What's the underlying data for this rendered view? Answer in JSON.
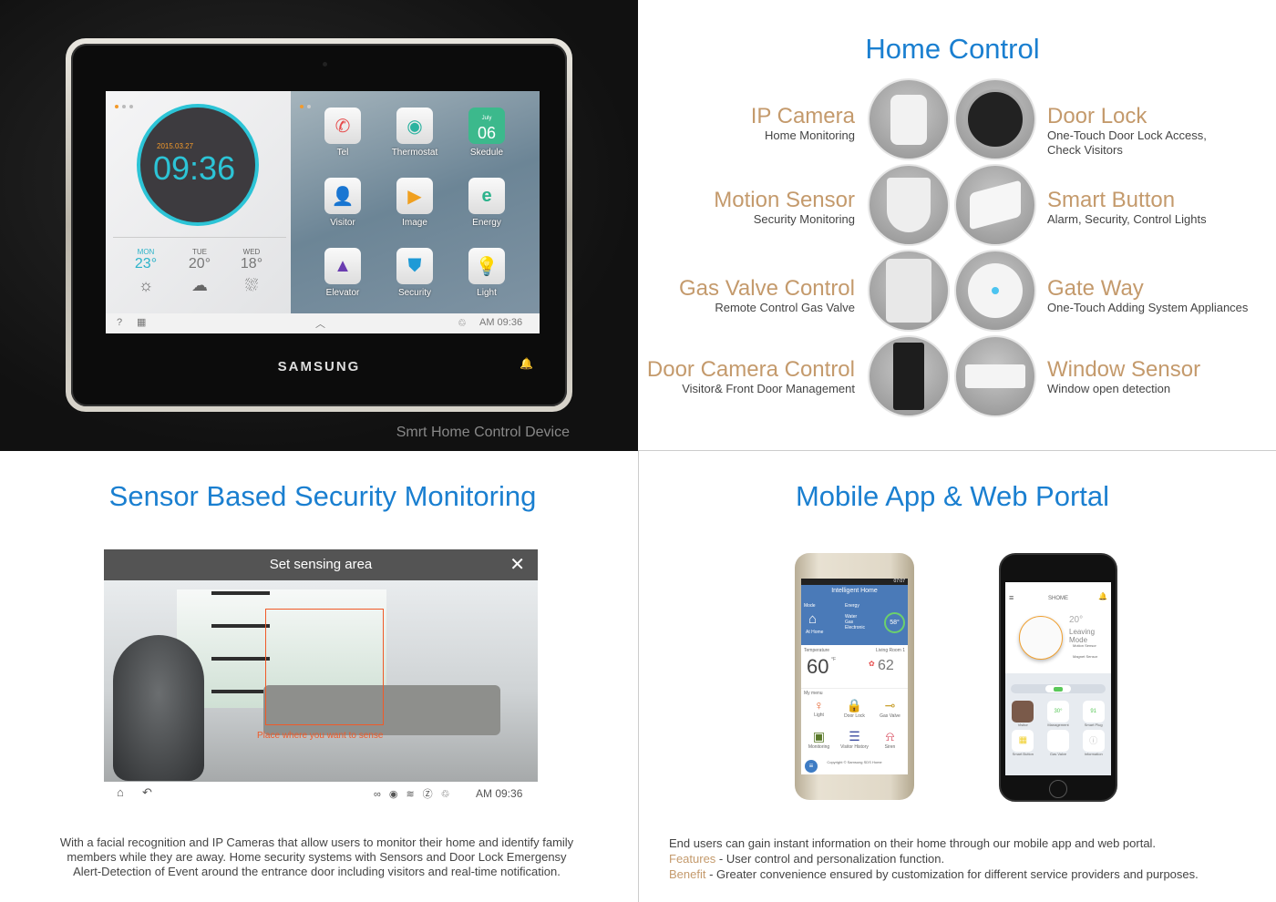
{
  "device": {
    "caption": "Smrt Home Control Device",
    "brand": "SAMSUNG",
    "clock": {
      "date": "2015.03.27",
      "time": "09:36"
    },
    "weather": [
      {
        "day": "MON",
        "temp": "23°",
        "icon": "sun-icon"
      },
      {
        "day": "TUE",
        "temp": "20°",
        "icon": "cloud-icon"
      },
      {
        "day": "WED",
        "temp": "18°",
        "icon": "rain-icon"
      }
    ],
    "apps": [
      {
        "label": "Tel",
        "icon": "phone-icon"
      },
      {
        "label": "Thermostat",
        "icon": "thermostat-icon"
      },
      {
        "label": "Skedule",
        "icon": "calendar-icon",
        "month": "July",
        "day": "06"
      },
      {
        "label": "Visitor",
        "icon": "visitor-icon"
      },
      {
        "label": "Image",
        "icon": "video-icon"
      },
      {
        "label": "Energy",
        "icon": "energy-icon"
      },
      {
        "label": "Elevator",
        "icon": "elevator-icon"
      },
      {
        "label": "Security",
        "icon": "shield-icon"
      },
      {
        "label": "Light",
        "icon": "bulb-icon"
      }
    ],
    "status": {
      "help": "?",
      "time": "AM 09:36"
    }
  },
  "home_control": {
    "title": "Home Control",
    "left": [
      {
        "name": "IP Camera",
        "desc": "Home Monitoring"
      },
      {
        "name": "Motion Sensor",
        "desc": "Security Monitoring"
      },
      {
        "name": "Gas Valve Control",
        "desc": "Remote Control Gas Valve"
      },
      {
        "name": "Door Camera Control",
        "desc": "Visitor& Front Door Management"
      }
    ],
    "right": [
      {
        "name": "Door Lock",
        "desc": "One-Touch Door Lock Access,",
        "desc2": "Check Visitors"
      },
      {
        "name": "Smart Button",
        "desc": "Alarm, Security, Control Lights"
      },
      {
        "name": "Gate Way",
        "desc": "One-Touch Adding System Appliances"
      },
      {
        "name": "Window Sensor",
        "desc": "Window open detection"
      }
    ]
  },
  "security": {
    "title": "Sensor Based Security Monitoring",
    "panel_title": "Set sensing area",
    "hint": "Place where you want to sense",
    "time": "AM 09:36",
    "description": "With a facial recognition and IP Cameras that allow users to monitor their home and identify family members while they are away. Home security systems with Sensors and Door Lock Emergensy Alert-Detection of Event around the entrance door including visitors and real-time notification.",
    "colors": {
      "accent": "#f05a28",
      "title": "#1a7fd0"
    }
  },
  "mobile": {
    "title": "Mobile App & Web Portal",
    "android": {
      "clock": "07:07",
      "title": "Intelligent Home",
      "mode": "Mode",
      "mode_value": "At Home",
      "energy": "Energy",
      "energy_items": [
        "Water",
        "Gas",
        "Electronic"
      ],
      "energy_pct": "58°",
      "temperature": "Temperature",
      "room": "Living Room 1",
      "current": "60",
      "target": "62",
      "unit": "°F",
      "my_menu": "My menu",
      "menu": [
        "Light",
        "Door Lock",
        "Gas Valve",
        "Monitoring",
        "Visitor History",
        "Siren"
      ],
      "copyright": "Copyright © Samsung SDS Home"
    },
    "iphone": {
      "title": "SHOME",
      "temp": "20°",
      "mode": "Leaving Mode",
      "sensors": [
        "Motion Sensor",
        "Magnet Sensor"
      ],
      "tiles": [
        "Visitor",
        "Management",
        "Smart Plug",
        "Smart Button",
        "Gas Valve",
        "Information"
      ],
      "mgmt_value": "30°",
      "plug_value": "91"
    },
    "intro": "End users can gain instant information on their home through our mobile app and web portal.",
    "features_label": "Features",
    "features": " - User control and personalization function.",
    "benefit_label": "Benefit",
    "benefit": " - Greater convenience ensured by customization for different service providers and purposes."
  }
}
